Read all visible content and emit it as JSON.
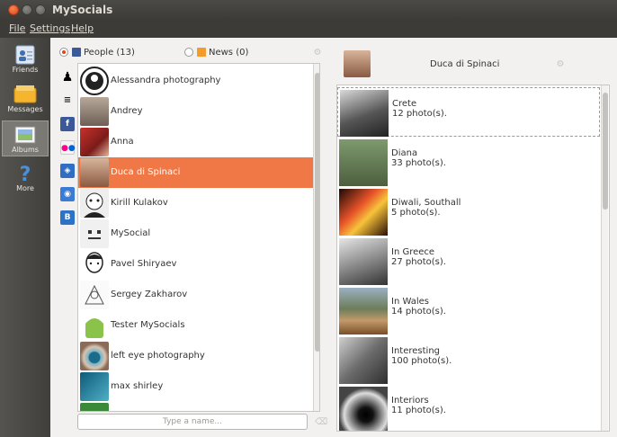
{
  "window": {
    "title": "MySocials"
  },
  "menu": {
    "items": [
      "File",
      "Settings",
      "Help"
    ]
  },
  "nav": {
    "items": [
      {
        "label": "Friends",
        "icon": "friends-icon"
      },
      {
        "label": "Messages",
        "icon": "messages-icon"
      },
      {
        "label": "Albums",
        "icon": "albums-icon",
        "selected": true
      },
      {
        "label": "More",
        "icon": "help-icon"
      }
    ]
  },
  "tabs": {
    "people": "People (13)",
    "news": "News (0)"
  },
  "services": [
    "person-icon",
    "list-icon",
    "facebook-icon",
    "flickr-icon",
    "picasa-icon",
    "camera-icon",
    "b-icon"
  ],
  "people": [
    {
      "name": "Alessandra photography"
    },
    {
      "name": "Andrey"
    },
    {
      "name": "Anna"
    },
    {
      "name": "Duca di Spinaci",
      "selected": true
    },
    {
      "name": "Kirill Kulakov"
    },
    {
      "name": "MySocial"
    },
    {
      "name": "Pavel Shiryaev"
    },
    {
      "name": "Sergey Zakharov"
    },
    {
      "name": "Tester MySocials"
    },
    {
      "name": "left eye photography"
    },
    {
      "name": "max shirley"
    }
  ],
  "search": {
    "placeholder": "Type a name..."
  },
  "selected_person": {
    "name": "Duca di Spinaci"
  },
  "albums": [
    {
      "title": "Crete",
      "count": "12 photo(s)."
    },
    {
      "title": "Diana",
      "count": "33 photo(s)."
    },
    {
      "title": "Diwali, Southall",
      "count": "5 photo(s)."
    },
    {
      "title": "In Greece",
      "count": "27 photo(s)."
    },
    {
      "title": "In Wales",
      "count": "14 photo(s)."
    },
    {
      "title": "Interesting",
      "count": "100 photo(s)."
    },
    {
      "title": "Interiors",
      "count": "11 photo(s)."
    }
  ],
  "colors": {
    "accent": "#f07846",
    "titlebar": "#3c3b37",
    "close": "#dd4814"
  }
}
